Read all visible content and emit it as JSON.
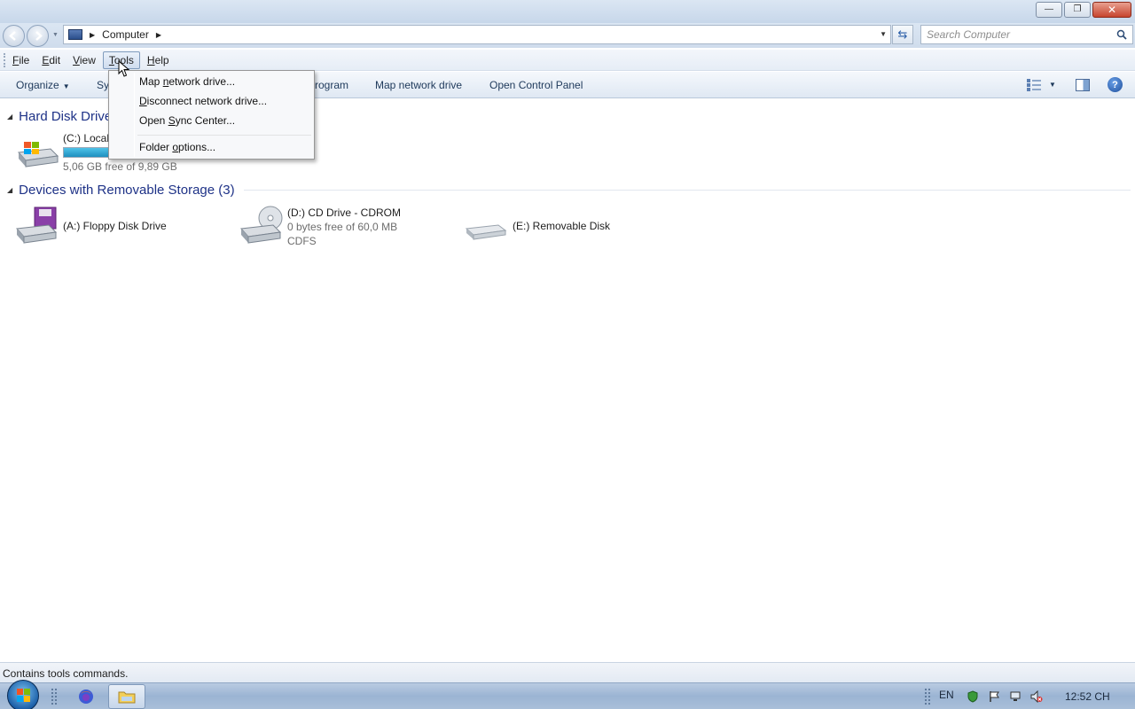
{
  "window": {
    "minimize_glyph": "—",
    "restore_glyph": "❐",
    "close_glyph": "✕"
  },
  "address": {
    "location": "Computer",
    "search_placeholder": "Search Computer"
  },
  "menubar": {
    "items": [
      {
        "label": "File",
        "underline": "F",
        "rest": "ile"
      },
      {
        "label": "Edit",
        "underline": "E",
        "rest": "dit"
      },
      {
        "label": "View",
        "underline": "V",
        "rest": "iew"
      },
      {
        "label": "Tools",
        "underline": "T",
        "rest": "ools"
      },
      {
        "label": "Help",
        "underline": "H",
        "rest": "elp"
      }
    ],
    "active": "Tools"
  },
  "commandbar": {
    "organize": "Organize",
    "system": "Sy",
    "program": "rogram",
    "map_drive": "Map network drive",
    "control_panel": "Open Control Panel"
  },
  "tools_menu": {
    "items": [
      {
        "pre": "Map ",
        "ul": "n",
        "post": "etwork drive..."
      },
      {
        "pre": "",
        "ul": "D",
        "post": "isconnect network drive..."
      },
      {
        "pre": "Open ",
        "ul": "S",
        "post": "ync Center..."
      },
      {
        "pre": "Folder ",
        "ul": "o",
        "post": "ptions..."
      }
    ]
  },
  "groups": {
    "hard_disk": "Hard Disk Drive",
    "removable": "Devices with Removable Storage (3)"
  },
  "drives": {
    "c": {
      "name": "(C:) Local",
      "free": "5,06 GB free of 9,89 GB",
      "used_fraction": 0.49
    },
    "a": {
      "name": "(A:) Floppy Disk Drive"
    },
    "d": {
      "name": "(D:) CD Drive - CDROM",
      "free": "0 bytes free of 60,0 MB",
      "fs": "CDFS"
    },
    "e": {
      "name": "(E:) Removable Disk"
    }
  },
  "status": {
    "text": "Contains tools commands."
  },
  "taskbar": {
    "lang": "EN",
    "clock": "12:52 CH"
  }
}
